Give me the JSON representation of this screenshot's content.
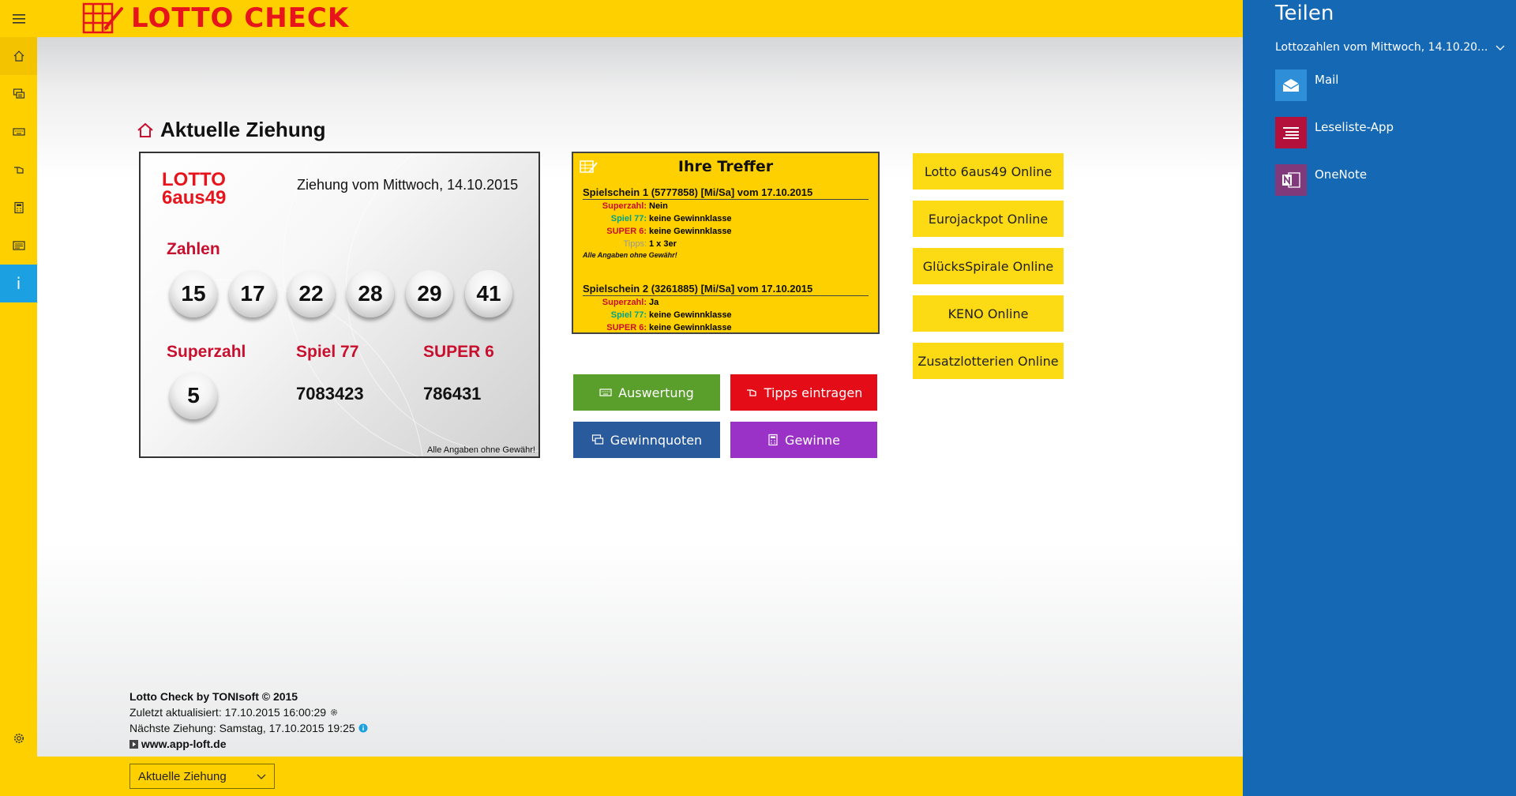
{
  "app": {
    "logo_text": "LOTTO CHECK"
  },
  "sidebar": {
    "items": [
      {
        "name": "home",
        "icon": "home-icon"
      },
      {
        "name": "quoten",
        "icon": "chat-icon"
      },
      {
        "name": "keyboard",
        "icon": "keyboard-icon"
      },
      {
        "name": "tipps",
        "icon": "hand-icon"
      },
      {
        "name": "calculator",
        "icon": "calculator-icon"
      },
      {
        "name": "tickets",
        "icon": "ticket-icon"
      },
      {
        "name": "info",
        "icon": "info-icon",
        "label": "i"
      }
    ],
    "settings_icon": "gear-icon"
  },
  "heading": {
    "title": "Aktuelle Ziehung"
  },
  "draw": {
    "logo_line1": "LOTTO",
    "logo_line2": "6aus49",
    "date": "Ziehung vom Mittwoch, 14.10.2015",
    "zahlen_label": "Zahlen",
    "numbers": [
      "15",
      "17",
      "22",
      "28",
      "29",
      "41"
    ],
    "superzahl_label": "Superzahl",
    "superzahl": "5",
    "spiel77_label": "Spiel 77",
    "spiel77": "7083423",
    "super6_label": "SUPER 6",
    "super6": "786431",
    "disclaimer": "Alle Angaben ohne Gewähr!"
  },
  "treffer": {
    "title": "Ihre Treffer",
    "tickets": [
      {
        "header": "Spielschein 1 (5777858) [Mi/Sa] vom 17.10.2015",
        "lines": [
          {
            "key": "Superzahl:",
            "value": "Nein"
          },
          {
            "key": "Spiel 77:",
            "value": "keine Gewinnklasse"
          },
          {
            "key": "SUPER 6:",
            "value": "keine Gewinnklasse"
          },
          {
            "key": "Tipps:",
            "value": "1 x 3er"
          }
        ],
        "note": "Alle Angaben ohne Gewähr!"
      },
      {
        "header": "Spielschein 2 (3261885) [Mi/Sa] vom 17.10.2015",
        "lines": [
          {
            "key": "Superzahl:",
            "value": "Ja"
          },
          {
            "key": "Spiel 77:",
            "value": "keine Gewinnklasse"
          },
          {
            "key": "SUPER 6:",
            "value": "keine Gewinnklasse"
          }
        ]
      }
    ]
  },
  "actions": {
    "auswertung": {
      "label": "Auswertung",
      "color": "#5A9E2C",
      "icon": "keyboard-icon"
    },
    "tipps": {
      "label": "Tipps eintragen",
      "color": "#E30C17",
      "icon": "hand-icon"
    },
    "gewinnquoten": {
      "label": "Gewinnquoten",
      "color": "#285A9C",
      "icon": "chat-icon"
    },
    "gewinne": {
      "label": "Gewinne",
      "color": "#9B32C8",
      "icon": "calculator-icon"
    }
  },
  "online": [
    "Lotto 6aus49 Online",
    "Eurojackpot Online",
    "GlücksSpirale Online",
    "KENO Online",
    "Zusatzlotterien Online"
  ],
  "footer": {
    "credit": "Lotto Check by TONIsoft © 2015",
    "updated": "Zuletzt aktualisiert: 17.10.2015 16:00:29",
    "next": "Nächste Ziehung: Samstag, 17.10.2015 19:25",
    "link": "www.app-loft.de"
  },
  "bottombar": {
    "selected_view": "Aktuelle Ziehung"
  },
  "share": {
    "title": "Teilen",
    "subject": "Lottozahlen vom Mittwoch, 14.10.20...",
    "targets": [
      {
        "label": "Mail",
        "icon": "mail-icon",
        "color": "#2E8FD8"
      },
      {
        "label": "Leseliste-App",
        "icon": "reading-list-icon",
        "color": "#B4103C"
      },
      {
        "label": "OneNote",
        "icon": "onenote-icon",
        "color": "#80397B"
      }
    ]
  },
  "colors": {
    "brand_yellow": "#FFD000",
    "brand_red": "#E8141B",
    "share_blue": "#1468B4",
    "info_blue": "#1BA1E2"
  }
}
